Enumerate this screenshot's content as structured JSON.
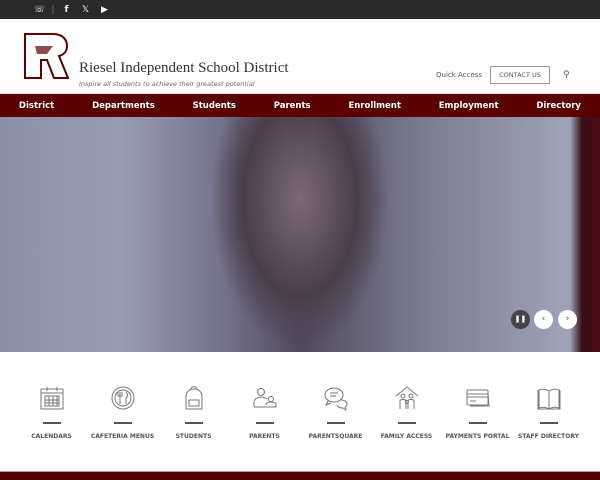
{
  "topbar": {
    "icons": [
      "parentsquare-icon",
      "facebook-icon",
      "x-icon",
      "youtube-icon"
    ]
  },
  "header": {
    "title": "Riesel Independent School District",
    "tagline": "Inspire all students to achieve their greatest potential",
    "quick_access": "Quick Access",
    "contact": "CONTACT US"
  },
  "nav": [
    "District",
    "Departments",
    "Students",
    "Parents",
    "Enrollment",
    "Employment",
    "Directory"
  ],
  "quicklinks": [
    {
      "label": "CALENDARS",
      "icon": "calendar-icon"
    },
    {
      "label": "CAFETERIA MENUS",
      "icon": "plate-utensils-icon"
    },
    {
      "label": "STUDENTS",
      "icon": "backpack-icon"
    },
    {
      "label": "PARENTS",
      "icon": "parent-child-icon"
    },
    {
      "label": "PARENTSQUARE",
      "icon": "chat-bubbles-icon"
    },
    {
      "label": "FAMILY ACCESS",
      "icon": "family-house-icon"
    },
    {
      "label": "PAYMENTS PORTAL",
      "icon": "credit-card-icon"
    },
    {
      "label": "STAFF DIRECTORY",
      "icon": "book-icon"
    }
  ],
  "colors": {
    "brand": "#5a0000",
    "topbar": "#2a2a2a"
  }
}
